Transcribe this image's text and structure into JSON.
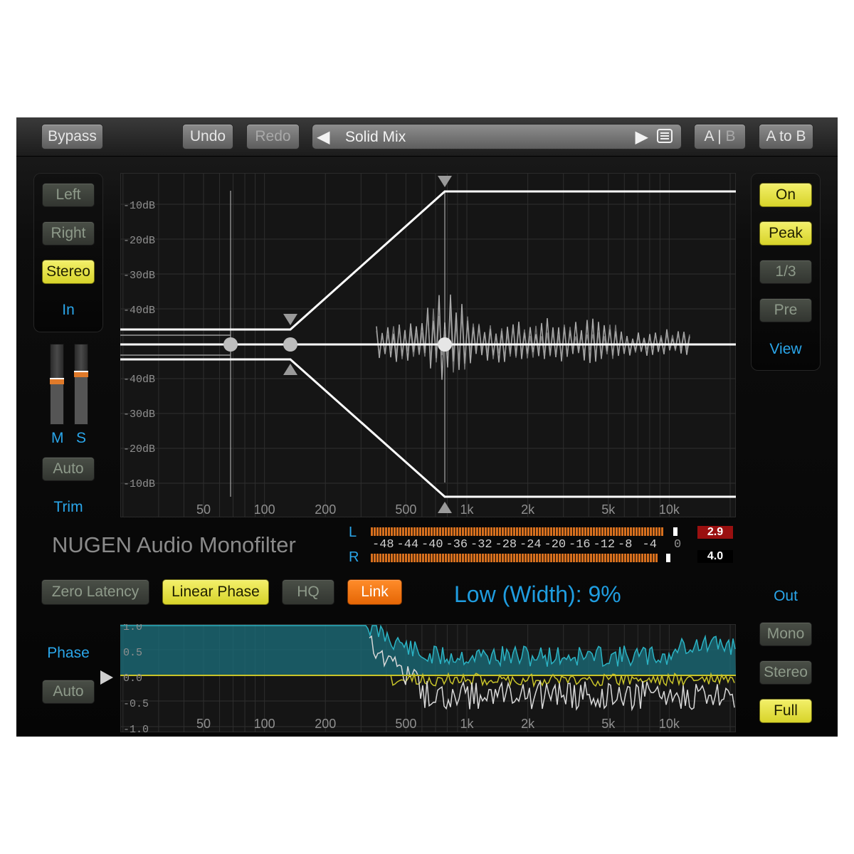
{
  "topbar": {
    "bypass_label": "Bypass",
    "undo_label": "Undo",
    "redo_label": "Redo",
    "preset_prev_icon": "◀",
    "preset_name": "Solid Mix",
    "preset_next_icon": "▶",
    "preset_list_icon": "list-icon",
    "ab_label_a": "A |",
    "ab_label_b": " B",
    "atob_label": "A to B"
  },
  "input": {
    "left_label": "Left",
    "right_label": "Right",
    "stereo_label": "Stereo",
    "section_label": "In",
    "selected": "Stereo"
  },
  "trim": {
    "m_label": "M",
    "s_label": "S",
    "m_level": 0.53,
    "s_level": 0.62,
    "auto_label": "Auto",
    "section_label": "Trim"
  },
  "view": {
    "on_label": "On",
    "peak_label": "Peak",
    "third_label": "1/3",
    "pre_label": "Pre",
    "section_label": "View"
  },
  "graph": {
    "db_labels_top": [
      "-10dB",
      "-20dB",
      "-30dB",
      "-40dB"
    ],
    "db_labels_bottom": [
      "-40dB",
      "-30dB",
      "-20dB",
      "-10dB"
    ],
    "freq_labels": [
      "50",
      "100",
      "200",
      "500",
      "1k",
      "2k",
      "5k",
      "10k"
    ],
    "freq_values": [
      50,
      100,
      200,
      500,
      1000,
      2000,
      5000,
      10000
    ]
  },
  "plugin_title": "NUGEN Audio Monofilter",
  "meter": {
    "l_label": "L",
    "r_label": "R",
    "scale": [
      "-48",
      "-44",
      "-40",
      "-36",
      "-32",
      "-28",
      "-24",
      "-20",
      "-16",
      "-12",
      "-8",
      "-4",
      "0"
    ],
    "l_peak": "2.9",
    "r_peak": "4.0",
    "l_peak_color": "#9a1010",
    "r_peak_color": "#000000"
  },
  "options": {
    "zero_latency_label": "Zero Latency",
    "linear_phase_label": "Linear Phase",
    "hq_label": "HQ",
    "link_label": "Link"
  },
  "width_readout": "Low (Width): 9%",
  "phase": {
    "section_label": "Phase",
    "auto_label": "Auto",
    "y_labels": [
      "1.0",
      "0.5",
      "0.0",
      "-0.5",
      "-1.0"
    ]
  },
  "output": {
    "section_label": "Out",
    "mono_label": "Mono",
    "stereo_label": "Stereo",
    "full_label": "Full",
    "selected": "Full"
  },
  "colors": {
    "accent_blue": "#2aa6ea",
    "active_yellow": "#e8e54a",
    "link_orange": "#f07412",
    "meter_orange": "#d8701e",
    "phase_teal": "#1f8e9c",
    "phase_yellow": "#c8c42a"
  }
}
